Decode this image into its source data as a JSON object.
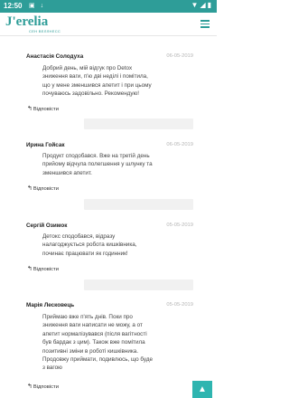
{
  "status_bar": {
    "time": "12:50",
    "left_icons": [
      "sim-icon",
      "download-icon"
    ],
    "right_icons": [
      "wifi-icon",
      "signal-icon",
      "battery-icon"
    ]
  },
  "header": {
    "logo": "J'erelia",
    "logo_subtitle": "СЕН ВЕЛЛНЕСС"
  },
  "reviews": [
    {
      "author": "Анастасія Солодуха",
      "date": "06-05-2019",
      "lines": [
        "Добрий день, мій відгук про Detox",
        "зниження ваги, п'ю дві неділі і помітила,",
        "що у мене зменшився апетит і при цьому",
        "почуваюсь задовільно. Рекомендую!"
      ],
      "reply_label": "Відповісти"
    },
    {
      "author": "Ирина Гойсак",
      "date": "06-05-2019",
      "lines": [
        "Продукт сподобався. Вже на третій день",
        "прийому відчула полегшення у шлунку та",
        "зменшився апетит."
      ],
      "reply_label": "Відповісти"
    },
    {
      "author": "Сергій Озимок",
      "date": "05-05-2019",
      "lines": [
        "Детокс сподобався, відразу",
        "налагоджується робота кишківника,",
        "починає працювати як годинник!"
      ],
      "reply_label": "Відповісти"
    },
    {
      "author": "Марія Лесковець",
      "date": "05-05-2019",
      "lines": [
        "Приймаю вже п'ять днів. Поки про",
        "зниження ваги написати не можу, а от",
        "апетит нормалізувався (після вагітності",
        "був бардак з цим). Також вже помітила",
        "позитивні зміни в роботі кишківника.",
        "Продовжу приймати, подивлюсь, що буде",
        "з вагою"
      ],
      "reply_label": "Відповісти"
    }
  ],
  "scroll_top_icon": "chevron-up-icon"
}
